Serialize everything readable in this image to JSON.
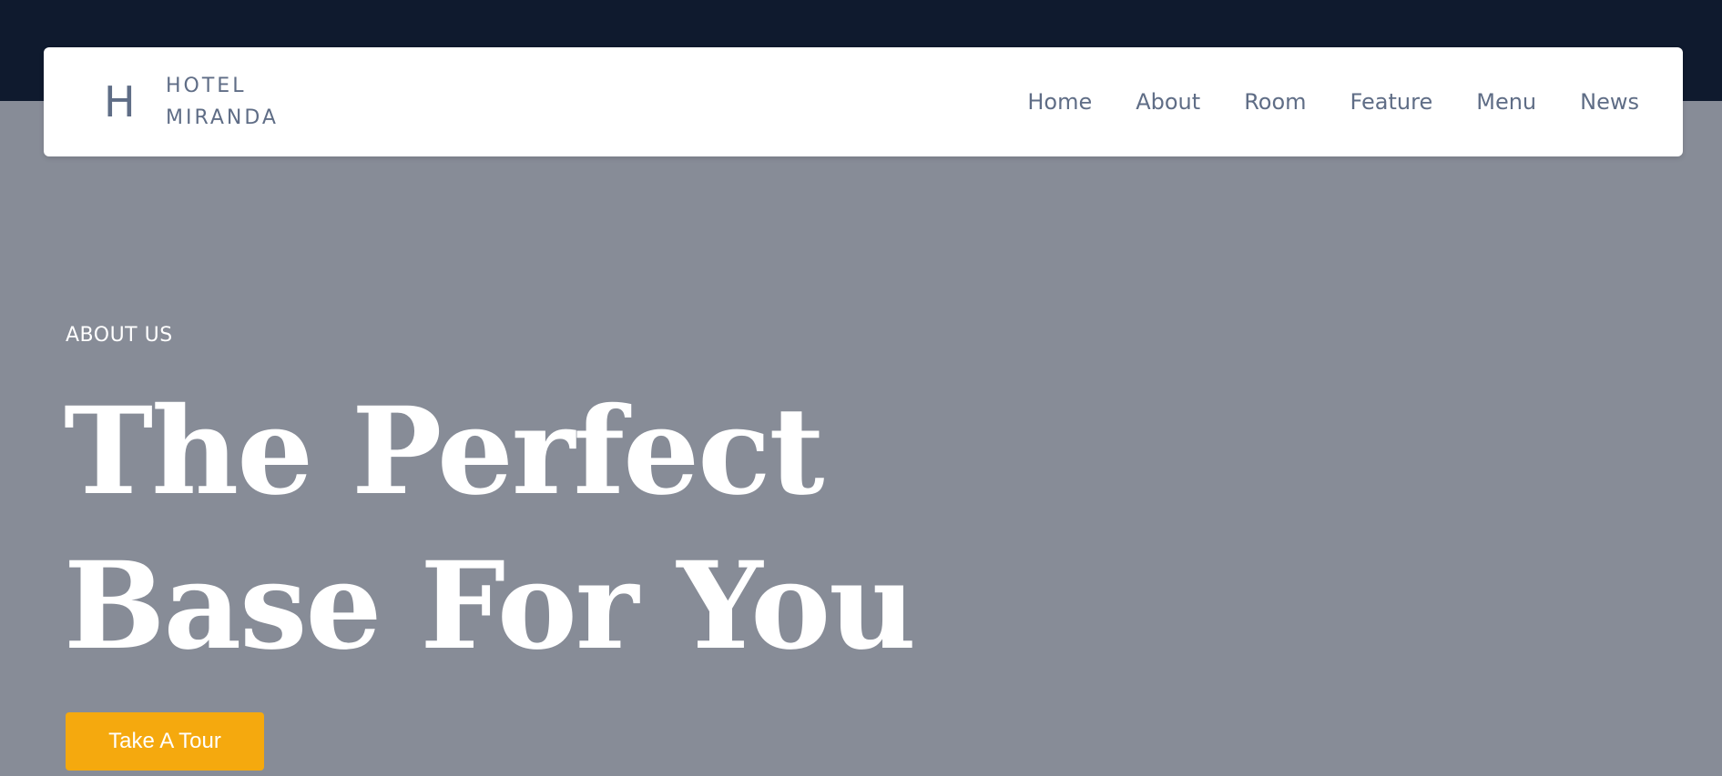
{
  "brand": {
    "logo_letter": "H",
    "name_line1": "HOTEL",
    "name_line2": "MIRANDA"
  },
  "nav": {
    "items": [
      {
        "label": "Home"
      },
      {
        "label": "About"
      },
      {
        "label": "Room"
      },
      {
        "label": "Feature"
      },
      {
        "label": "Menu"
      },
      {
        "label": "News"
      }
    ]
  },
  "hero": {
    "eyebrow": "ABOUT US",
    "headline_line1": "The Perfect",
    "headline_line2": "Base For You",
    "cta_label": "Take A Tour"
  },
  "colors": {
    "top_band": "#0f1a2e",
    "hero_background": "#878c97",
    "nav_text": "#5f6d86",
    "cta_background": "#f5a90e"
  }
}
